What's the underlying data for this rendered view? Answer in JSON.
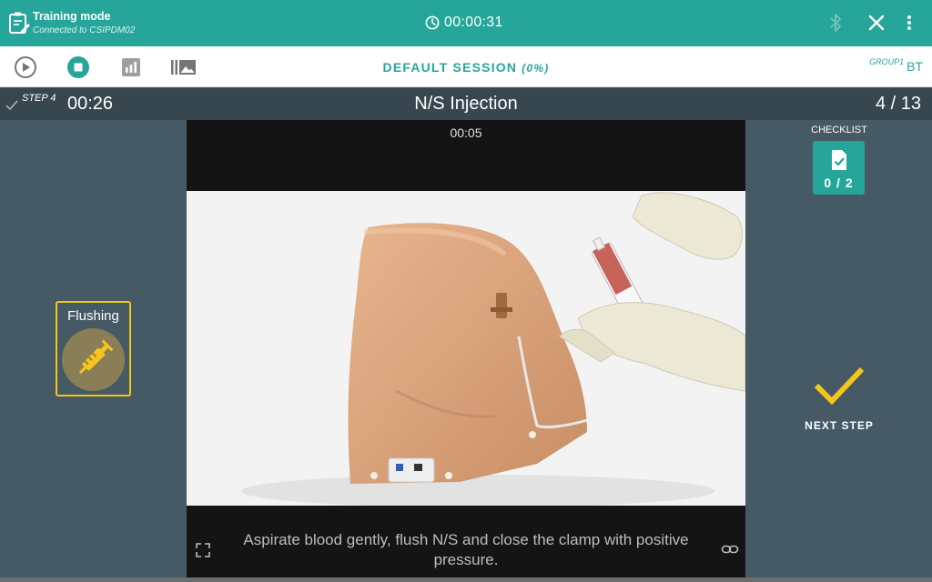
{
  "topbar": {
    "mode_title": "Training mode",
    "mode_subtitle": "Connected to CSIPDM02",
    "session_timer": "00:00:31",
    "icons": [
      "clipboard-edit-icon",
      "clock-icon",
      "bluetooth-icon",
      "close-icon",
      "more-vert-icon"
    ]
  },
  "toolbar": {
    "session_name": "DEFAULT SESSION",
    "session_progress": "(0%)",
    "group_label": "GROUP1",
    "group_code": "BT",
    "icons": [
      "play-circle-icon",
      "stop-circle-icon",
      "stats-icon",
      "gallery-icon"
    ]
  },
  "step": {
    "label": "STEP 4",
    "elapsed": "00:26",
    "title": "N/S Injection",
    "position": "4 / 13"
  },
  "video": {
    "timestamp": "00:05",
    "caption": "Aspirate blood gently, flush N/S and close the clamp with positive pressure."
  },
  "tool": {
    "label": "Flushing",
    "icon": "syringe-icon"
  },
  "checklist": {
    "label": "CHECKLIST",
    "count": "0 / 2"
  },
  "next_step": {
    "label": "NEXT STEP"
  },
  "colors": {
    "primary": "#26a69a",
    "background": "#455a64",
    "stepbar": "#37474f",
    "accent": "#f6c51b",
    "tool_circle": "#8a7e56"
  }
}
